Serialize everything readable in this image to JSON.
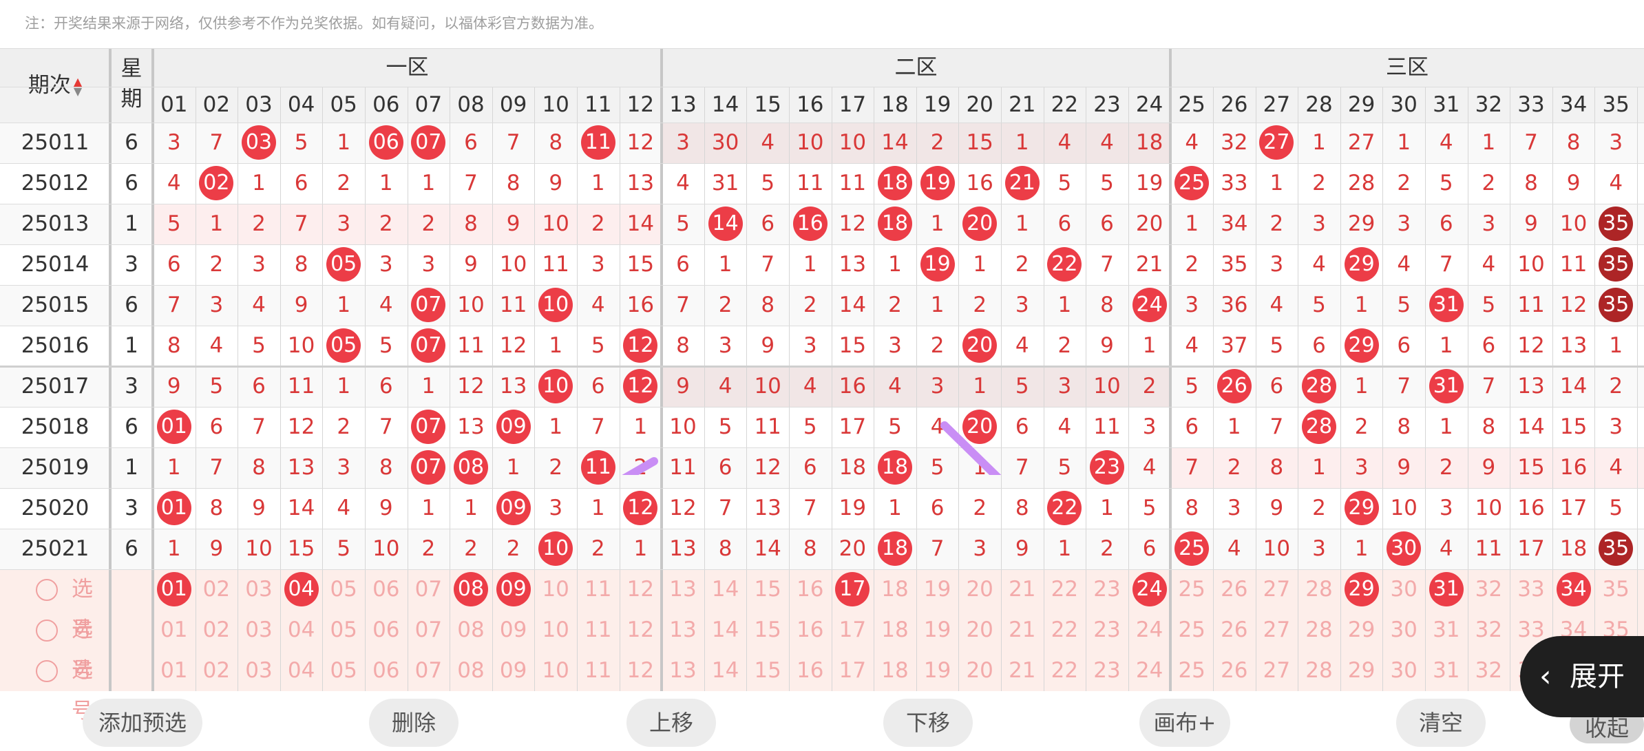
{
  "notice": "注：开奖结果来源于网络，仅供参考不作为兑奖依据。如有疑问，以福体彩官方数据为准。",
  "header": {
    "period_label": "期次",
    "sort_icon": "sort-arrows-icon",
    "week_label_top": "星",
    "week_label_bottom": "期",
    "zones": [
      "一区",
      "二区",
      "三区"
    ],
    "numbers": [
      "01",
      "02",
      "03",
      "04",
      "05",
      "06",
      "07",
      "08",
      "09",
      "10",
      "11",
      "12",
      "13",
      "14",
      "15",
      "16",
      "17",
      "18",
      "19",
      "20",
      "21",
      "22",
      "23",
      "24",
      "25",
      "26",
      "27",
      "28",
      "29",
      "30",
      "31",
      "32",
      "33",
      "34",
      "35"
    ]
  },
  "rows": [
    {
      "period": "25011",
      "week": "6",
      "cells": [
        "3",
        "7",
        "03",
        "5",
        "1",
        "06",
        "07",
        "6",
        "7",
        "8",
        "11",
        "12",
        "3",
        "30",
        "4",
        "10",
        "10",
        "14",
        "2",
        "15",
        "1",
        "4",
        "4",
        "18",
        "4",
        "32",
        "27",
        "1",
        "27",
        "1",
        "4",
        "1",
        "7",
        "8",
        "3"
      ],
      "balls": [
        2,
        5,
        6,
        10,
        26
      ]
    },
    {
      "period": "25012",
      "week": "6",
      "cells": [
        "4",
        "02",
        "1",
        "6",
        "2",
        "1",
        "1",
        "7",
        "8",
        "9",
        "1",
        "13",
        "4",
        "31",
        "5",
        "11",
        "11",
        "18",
        "19",
        "16",
        "21",
        "5",
        "5",
        "19",
        "25",
        "33",
        "1",
        "2",
        "28",
        "2",
        "5",
        "2",
        "8",
        "9",
        "4"
      ],
      "balls": [
        1,
        17,
        18,
        20,
        24
      ]
    },
    {
      "period": "25013",
      "week": "1",
      "cells": [
        "5",
        "1",
        "2",
        "7",
        "3",
        "2",
        "2",
        "8",
        "9",
        "10",
        "2",
        "14",
        "5",
        "14",
        "6",
        "16",
        "12",
        "18",
        "1",
        "20",
        "1",
        "6",
        "6",
        "20",
        "1",
        "34",
        "2",
        "3",
        "29",
        "3",
        "6",
        "3",
        "9",
        "10",
        "35"
      ],
      "balls": [
        13,
        15,
        17,
        19,
        34
      ]
    },
    {
      "period": "25014",
      "week": "3",
      "cells": [
        "6",
        "2",
        "3",
        "8",
        "05",
        "3",
        "3",
        "9",
        "10",
        "11",
        "3",
        "15",
        "6",
        "1",
        "7",
        "1",
        "13",
        "1",
        "19",
        "1",
        "2",
        "22",
        "7",
        "21",
        "2",
        "35",
        "3",
        "4",
        "29",
        "4",
        "7",
        "4",
        "10",
        "11",
        "35"
      ],
      "balls": [
        4,
        18,
        21,
        28,
        34
      ]
    },
    {
      "period": "25015",
      "week": "6",
      "cells": [
        "7",
        "3",
        "4",
        "9",
        "1",
        "4",
        "07",
        "10",
        "11",
        "10",
        "4",
        "16",
        "7",
        "2",
        "8",
        "2",
        "14",
        "2",
        "1",
        "2",
        "3",
        "1",
        "8",
        "24",
        "3",
        "36",
        "4",
        "5",
        "1",
        "5",
        "31",
        "5",
        "11",
        "12",
        "35"
      ],
      "balls": [
        6,
        9,
        23,
        30,
        34
      ]
    },
    {
      "period": "25016",
      "week": "1",
      "cells": [
        "8",
        "4",
        "5",
        "10",
        "05",
        "5",
        "07",
        "11",
        "12",
        "1",
        "5",
        "12",
        "8",
        "3",
        "9",
        "3",
        "15",
        "3",
        "2",
        "20",
        "4",
        "2",
        "9",
        "1",
        "4",
        "37",
        "5",
        "6",
        "29",
        "6",
        "1",
        "6",
        "12",
        "13",
        "1"
      ],
      "balls": [
        4,
        6,
        11,
        19,
        28
      ]
    },
    {
      "period": "25017",
      "week": "3",
      "cells": [
        "9",
        "5",
        "6",
        "11",
        "1",
        "6",
        "1",
        "12",
        "13",
        "10",
        "6",
        "12",
        "9",
        "4",
        "10",
        "4",
        "16",
        "4",
        "3",
        "1",
        "5",
        "3",
        "10",
        "2",
        "5",
        "26",
        "6",
        "28",
        "1",
        "7",
        "31",
        "7",
        "13",
        "14",
        "2"
      ],
      "balls": [
        9,
        11,
        25,
        27,
        30
      ]
    },
    {
      "period": "25018",
      "week": "6",
      "cells": [
        "01",
        "6",
        "7",
        "12",
        "2",
        "7",
        "07",
        "13",
        "09",
        "1",
        "7",
        "1",
        "10",
        "5",
        "11",
        "5",
        "17",
        "5",
        "4",
        "20",
        "6",
        "4",
        "11",
        "3",
        "6",
        "1",
        "7",
        "28",
        "2",
        "8",
        "1",
        "8",
        "14",
        "15",
        "3"
      ],
      "balls": [
        0,
        6,
        8,
        19,
        27
      ]
    },
    {
      "period": "25019",
      "week": "1",
      "cells": [
        "1",
        "7",
        "8",
        "13",
        "3",
        "8",
        "07",
        "08",
        "1",
        "2",
        "11",
        "2",
        "11",
        "6",
        "12",
        "6",
        "18",
        "18",
        "5",
        "1",
        "7",
        "5",
        "23",
        "4",
        "7",
        "2",
        "8",
        "1",
        "3",
        "9",
        "2",
        "9",
        "15",
        "16",
        "4"
      ],
      "balls": [
        6,
        7,
        10,
        17,
        22
      ]
    },
    {
      "period": "25020",
      "week": "3",
      "cells": [
        "01",
        "8",
        "9",
        "14",
        "4",
        "9",
        "1",
        "1",
        "09",
        "3",
        "1",
        "12",
        "12",
        "7",
        "13",
        "7",
        "19",
        "1",
        "6",
        "2",
        "8",
        "22",
        "1",
        "5",
        "8",
        "3",
        "9",
        "2",
        "29",
        "10",
        "3",
        "10",
        "16",
        "17",
        "5"
      ],
      "balls": [
        0,
        8,
        11,
        21,
        28
      ]
    },
    {
      "period": "25021",
      "week": "6",
      "cells": [
        "1",
        "9",
        "10",
        "15",
        "5",
        "10",
        "2",
        "2",
        "2",
        "10",
        "2",
        "1",
        "13",
        "8",
        "14",
        "8",
        "20",
        "18",
        "7",
        "3",
        "9",
        "1",
        "2",
        "6",
        "25",
        "4",
        "10",
        "3",
        "1",
        "30",
        "4",
        "11",
        "17",
        "18",
        "35"
      ],
      "balls": [
        9,
        17,
        24,
        29,
        34
      ]
    }
  ],
  "select_rows": [
    {
      "label": "选号",
      "balls": [
        0,
        3,
        7,
        8,
        16,
        23,
        28,
        30,
        33
      ]
    },
    {
      "label": "选号",
      "balls": []
    },
    {
      "label": "选号",
      "balls": []
    }
  ],
  "buttons": {
    "add": "添加预选",
    "delete": "删除",
    "up": "上移",
    "down": "下移",
    "canvas": "画布+",
    "clear": "清空",
    "collapse": "收起",
    "expand": "展开"
  },
  "colors": {
    "accent": "#ec3d47",
    "dark_ball": "#ad2526",
    "arrow": "#c98ef5"
  }
}
